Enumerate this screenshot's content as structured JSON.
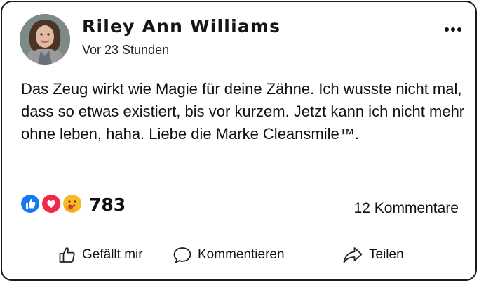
{
  "post": {
    "author": "Riley Ann Williams",
    "timestamp": "Vor 23 Stunden",
    "text": "Das Zeug wirkt wie Magie für deine Zähne. Ich wusste nicht mal, dass so etwas existiert, bis vor kurzem. Jetzt kann ich nicht mehr ohne leben, haha. Liebe die Marke Cleansmile™."
  },
  "reactions": {
    "icons": [
      "like-icon",
      "love-icon",
      "care-icon"
    ],
    "count": "783",
    "comments_label": "12 Kommentare"
  },
  "actions": {
    "like_label": "Gefällt mir",
    "comment_label": "Kommentieren",
    "share_label": "Teilen"
  },
  "colors": {
    "like_blue": "#1877f2",
    "love_red": "#f02849",
    "care_yellow": "#f7b928",
    "divider": "#c9c9c9"
  }
}
